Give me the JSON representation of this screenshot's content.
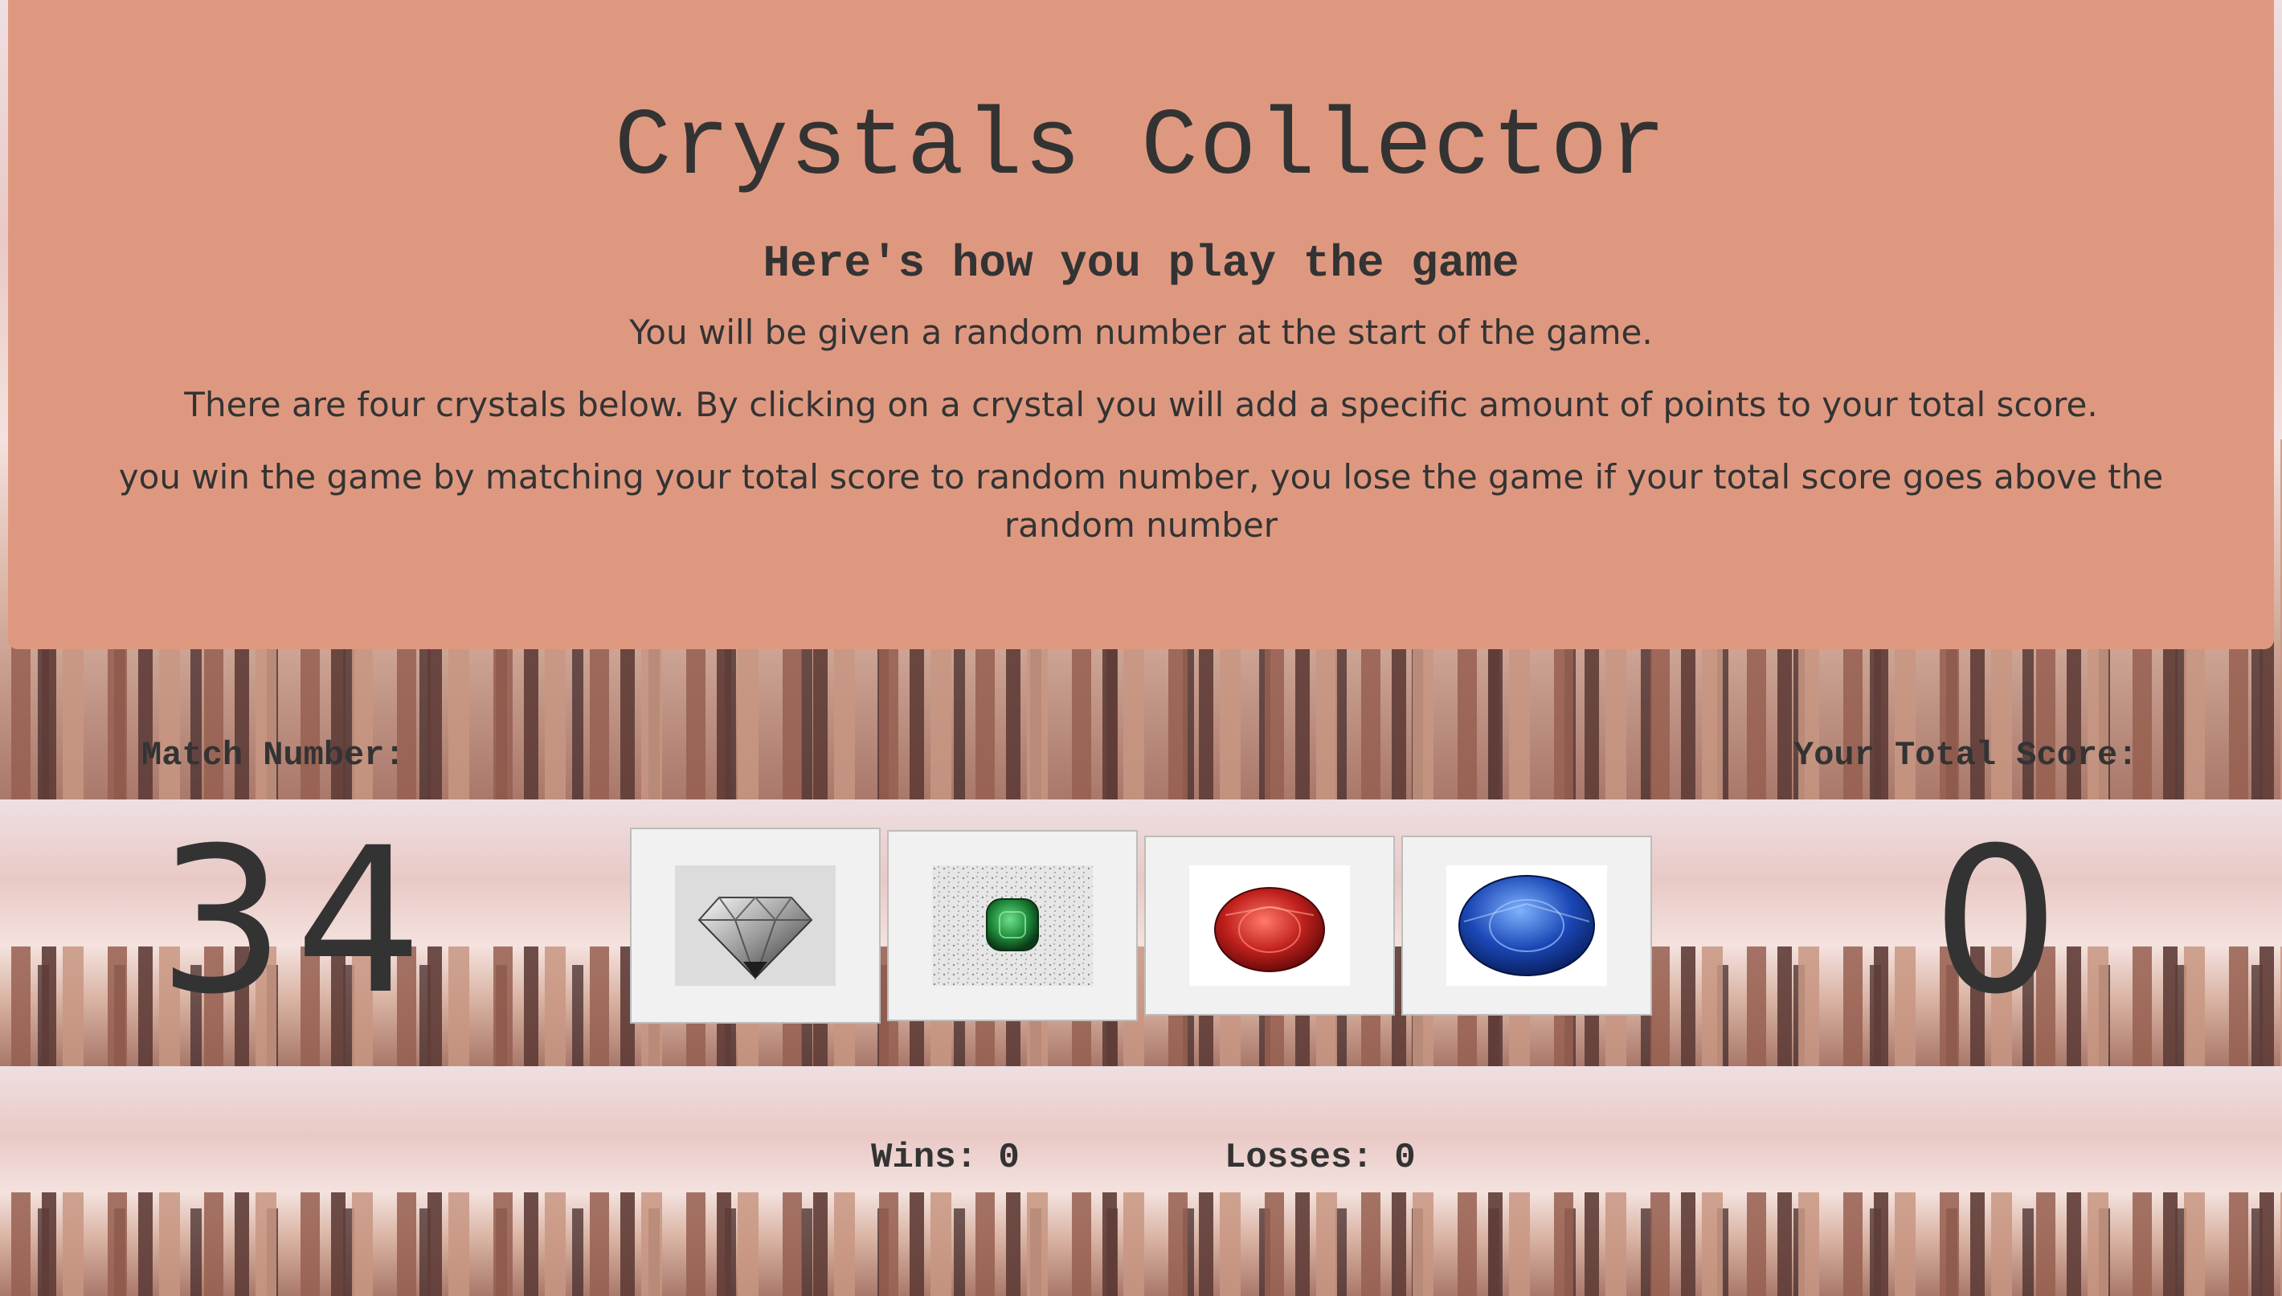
{
  "header": {
    "title": "Crystals Collector",
    "subtitle": "Here's how you play the game",
    "instructions": [
      "You will be given a random number at the start of the game.",
      "There are four crystals below. By clicking on a crystal you will add a specific amount of points to your total score.",
      "you win the game by matching your total score to random number, you lose the game if your total score goes above the random number"
    ]
  },
  "game": {
    "match_label": "Match Number:",
    "match_number": "34",
    "total_label": "Your Total Score:",
    "total_score": "0",
    "crystals": [
      {
        "name": "diamond-crystal",
        "icon": "clear-diamond",
        "color": "#c9c9c9"
      },
      {
        "name": "emerald-crystal",
        "icon": "green-emerald",
        "color": "#1f8a3a"
      },
      {
        "name": "ruby-crystal",
        "icon": "red-ruby",
        "color": "#c0201c"
      },
      {
        "name": "sapphire-crystal",
        "icon": "blue-sapphire",
        "color": "#1b47b5"
      }
    ],
    "wins_label": "Wins: 0",
    "losses_label": "Losses: 0"
  },
  "colors": {
    "jumbotron": "#df9880",
    "text": "#333333"
  }
}
